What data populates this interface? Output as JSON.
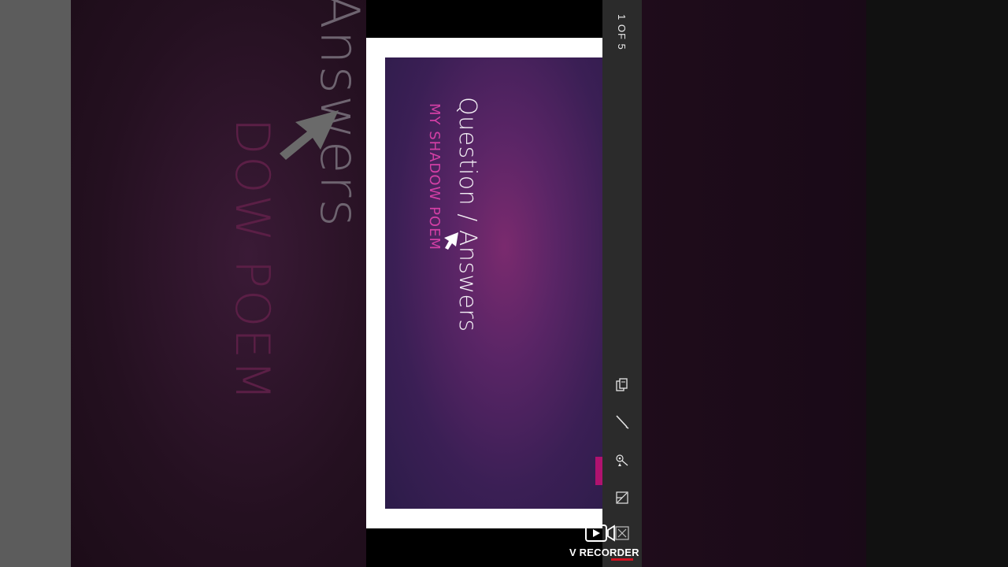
{
  "slide": {
    "title": "Question / Answers",
    "subtitle": "MY SHADOW POEM"
  },
  "viewer": {
    "page_counter": "1 OF 5",
    "tools": [
      "copy-icon",
      "pen-icon",
      "laser-pointer-icon",
      "resize-icon"
    ]
  },
  "background_ghost": {
    "title": "Answers",
    "subtitle": "DOW POEM"
  },
  "watermark": {
    "label": "V RECORDER"
  },
  "colors": {
    "slide_gradient_center": "#7a2a6e",
    "slide_gradient_edge": "#2c1c49",
    "subtitle": "#d33fa5",
    "accent": "#b0126f",
    "toolbar": "#2b2b2b"
  }
}
